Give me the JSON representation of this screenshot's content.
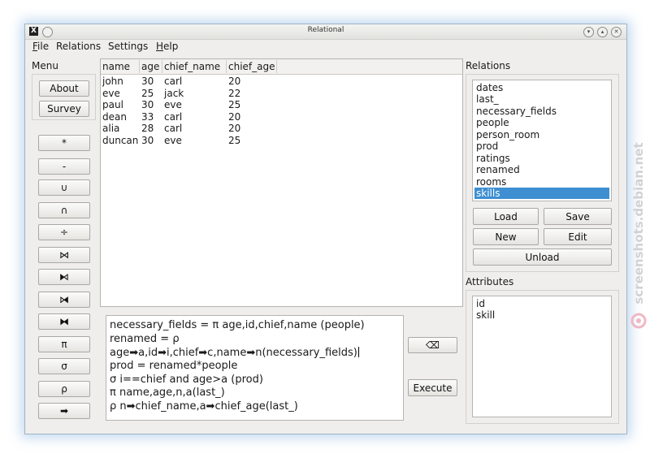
{
  "window": {
    "title": "Relational"
  },
  "menubar": [
    {
      "label": "ile",
      "mnemonic": "F"
    },
    {
      "label": "Relations",
      "mnemonic": ""
    },
    {
      "label": "Settings",
      "mnemonic": ""
    },
    {
      "label": "elp",
      "mnemonic": "H"
    }
  ],
  "menu_panel": {
    "label": "Menu",
    "about": "About",
    "survey": "Survey",
    "operators": [
      "*",
      "-",
      "∪",
      "∩",
      "÷",
      "⋈",
      "⧑",
      "⧒",
      "⧓",
      "π",
      "σ",
      "ρ",
      "➡"
    ]
  },
  "result_table": {
    "headers": [
      "name",
      "age",
      "chief_name",
      "chief_age"
    ],
    "rows": [
      [
        "john",
        "30",
        "carl",
        "20"
      ],
      [
        "eve",
        "25",
        "jack",
        "22"
      ],
      [
        "paul",
        "30",
        "eve",
        "25"
      ],
      [
        "dean",
        "33",
        "carl",
        "20"
      ],
      [
        "alia",
        "28",
        "carl",
        "20"
      ],
      [
        "duncan",
        "30",
        "eve",
        "25"
      ]
    ]
  },
  "query_editor": {
    "lines": [
      "necessary_fields = π age,id,chief,name (people)",
      "renamed = ρ",
      "age➡a,id➡i,chief➡c,name➡n(necessary_fields)",
      "prod = renamed*people",
      "σ i==chief and age>a (prod)",
      "π name,age,n,a(last_)",
      "ρ n➡chief_name,a➡chief_age(last_)"
    ]
  },
  "actions": {
    "clear": "⌫",
    "execute": "Execute"
  },
  "relations_panel": {
    "label": "Relations",
    "items": [
      "dates",
      "last_",
      "necessary_fields",
      "people",
      "person_room",
      "prod",
      "ratings",
      "renamed",
      "rooms",
      "skills"
    ],
    "selected": "skills",
    "load": "Load",
    "save": "Save",
    "new": "New",
    "edit": "Edit",
    "unload": "Unload"
  },
  "attributes_panel": {
    "label": "Attributes",
    "items": [
      "id",
      "skill"
    ]
  },
  "colors": {
    "selection": "#3d8fd1",
    "glow": "#78aadc"
  },
  "watermark": "screenshots.debian.net"
}
